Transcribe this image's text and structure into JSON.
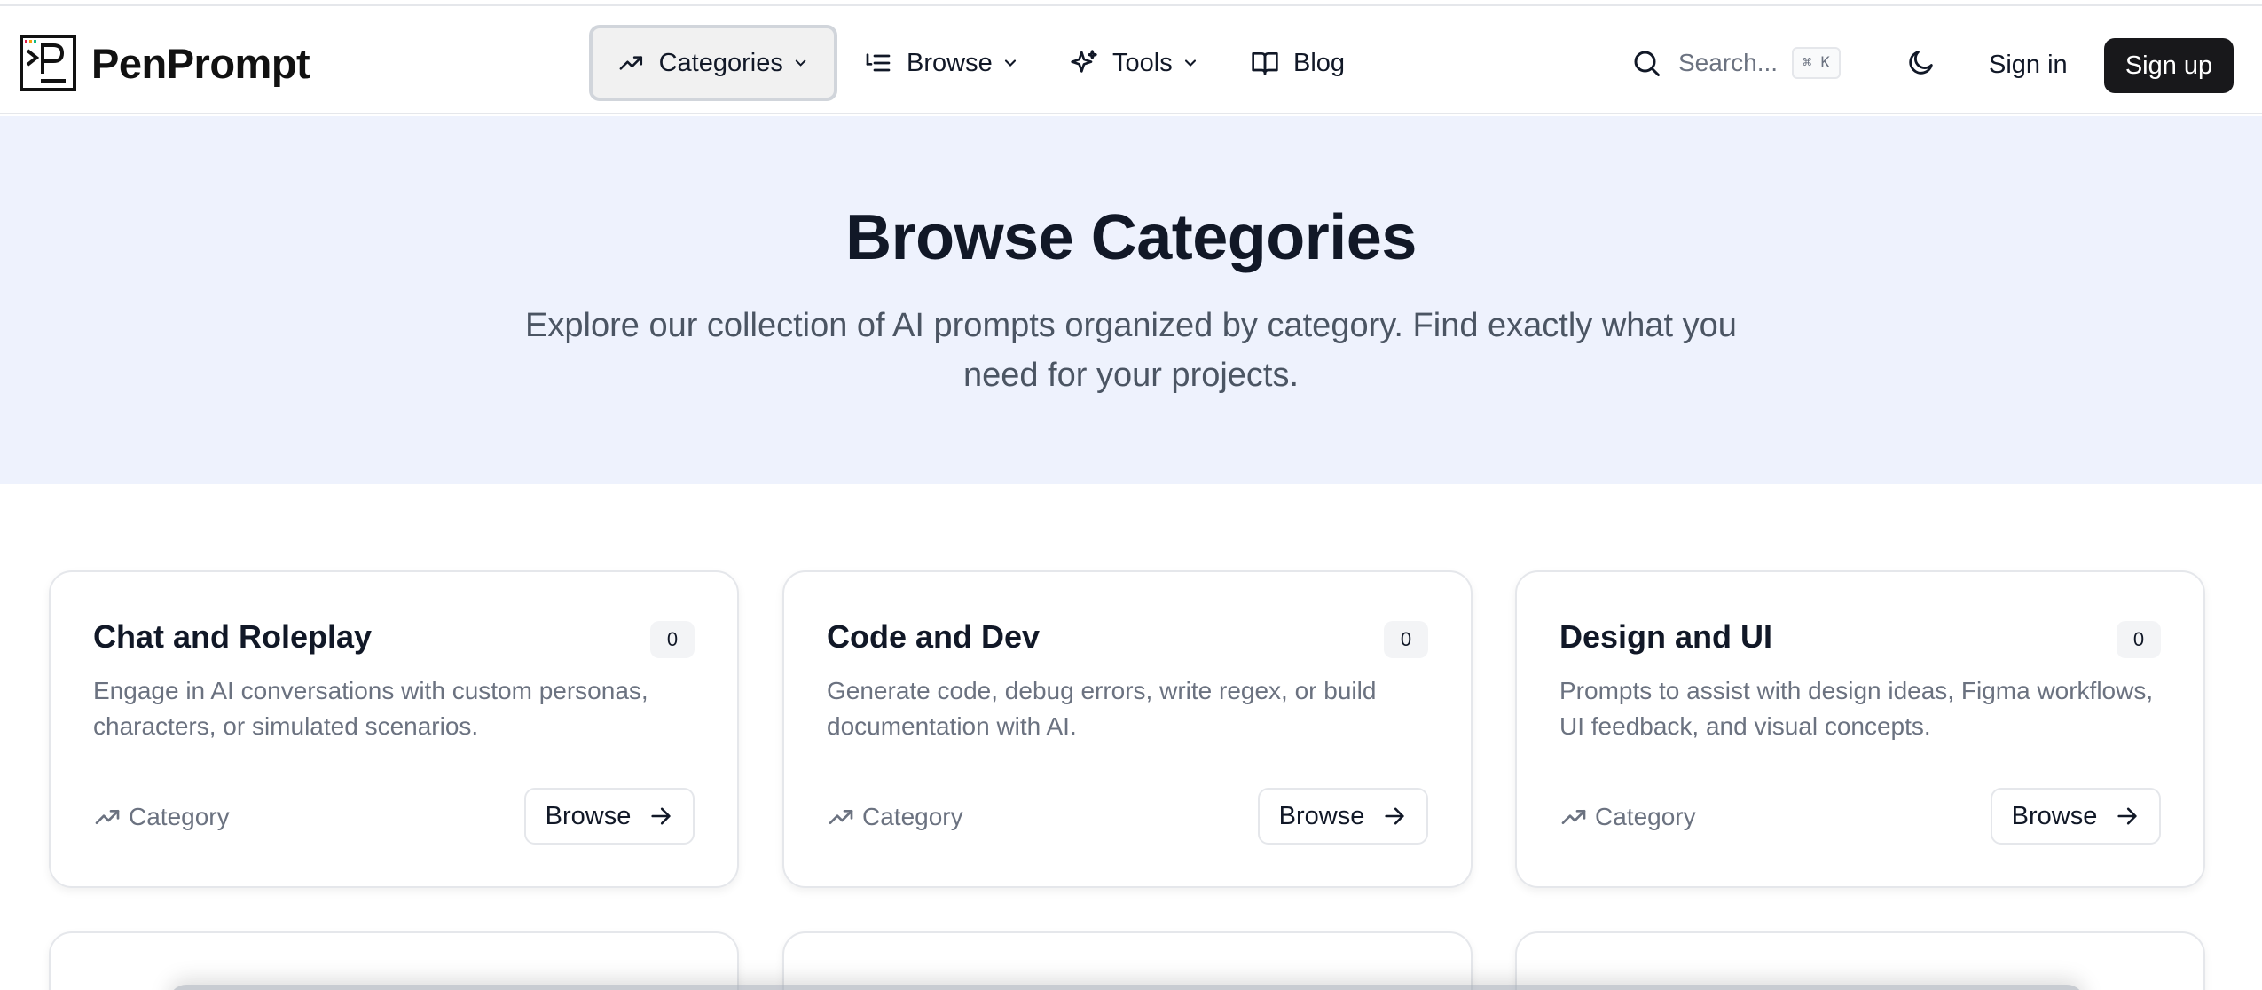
{
  "brand": {
    "name": "PenPrompt",
    "logo": "terminal-p-logo"
  },
  "nav": {
    "items": [
      {
        "label": "Categories",
        "icon": "trending-up-icon",
        "has_dropdown": true,
        "active": true
      },
      {
        "label": "Browse",
        "icon": "list-icon",
        "has_dropdown": true,
        "active": false
      },
      {
        "label": "Tools",
        "icon": "sparkles-icon",
        "has_dropdown": true,
        "active": false
      },
      {
        "label": "Blog",
        "icon": "book-open-icon",
        "has_dropdown": false,
        "active": false
      }
    ]
  },
  "search": {
    "placeholder": "Search...",
    "shortcut": "⌘ K"
  },
  "auth": {
    "signin_label": "Sign in",
    "signup_label": "Sign up"
  },
  "hero": {
    "title": "Browse Categories",
    "subtitle": "Explore our collection of AI prompts organized by category. Find exactly what you need for your projects."
  },
  "cards": [
    {
      "title": "Chat and Roleplay",
      "count": "0",
      "description": "Engage in AI conversations with custom personas, characters, or simulated scenarios.",
      "meta_label": "Category",
      "browse_label": "Browse"
    },
    {
      "title": "Code and Dev",
      "count": "0",
      "description": "Generate code, debug errors, write regex, or build documentation with AI.",
      "meta_label": "Category",
      "browse_label": "Browse"
    },
    {
      "title": "Design and UI",
      "count": "0",
      "description": "Prompts to assist with design ideas, Figma workflows, UI feedback, and visual concepts.",
      "meta_label": "Category",
      "browse_label": "Browse"
    }
  ],
  "colors": {
    "hero_background": "#eef2fd",
    "primary_button": "#18181b",
    "text_primary": "#111827",
    "text_muted": "#6b7280",
    "border": "#e5e7eb"
  }
}
